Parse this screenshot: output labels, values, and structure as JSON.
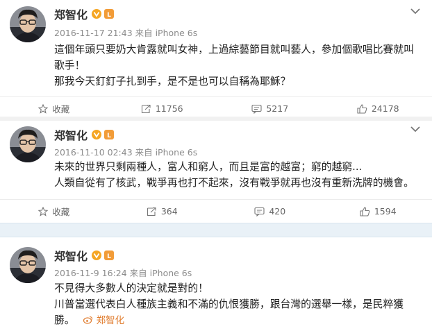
{
  "posts": [
    {
      "author": "郑智化",
      "meta": "2016-11-17 21:43 来自 iPhone 6s",
      "lines": [
        "這個年頭只要奶大肯露就叫女神，上過綜藝節目就叫藝人，參加個歌唱比賽就叫",
        "歌手！",
        "那我今天釘釘子扎到手，是不是也可以自稱為耶穌？"
      ],
      "actions": {
        "favorite": "收藏",
        "repost": "11756",
        "comment": "5217",
        "like": "24178"
      }
    },
    {
      "author": "郑智化",
      "meta": "2016-11-10 02:43 来自 iPhone 6s",
      "lines": [
        "未來的世界只剩兩種人，富人和窮人，而且是富的越富；窮的越窮...",
        "人類自從有了核武，戰爭再也打不起來，沒有戰爭就再也沒有重新洗牌的機會。"
      ],
      "actions": {
        "favorite": "收藏",
        "repost": "364",
        "comment": "420",
        "like": "1594"
      }
    },
    {
      "author": "郑智化",
      "meta": "2016-11-9 16:24 来自 iPhone 6s",
      "lines": [
        "不見得大多數人的決定就是對的！",
        "川普當選代表白人種族主義和不滿的仇恨獲勝，跟台灣的選舉一樣，是民粹獲"
      ],
      "last_line_start": "勝。",
      "watermark": "郑智化"
    }
  ],
  "colors": {
    "verified": "#f5a623",
    "mention": "#e07b2c",
    "divider_blue": "#e9f1f7"
  },
  "icons": [
    "chevron-down-icon",
    "star-icon",
    "repost-icon",
    "comment-icon",
    "like-icon",
    "verified-icon",
    "level-icon"
  ]
}
